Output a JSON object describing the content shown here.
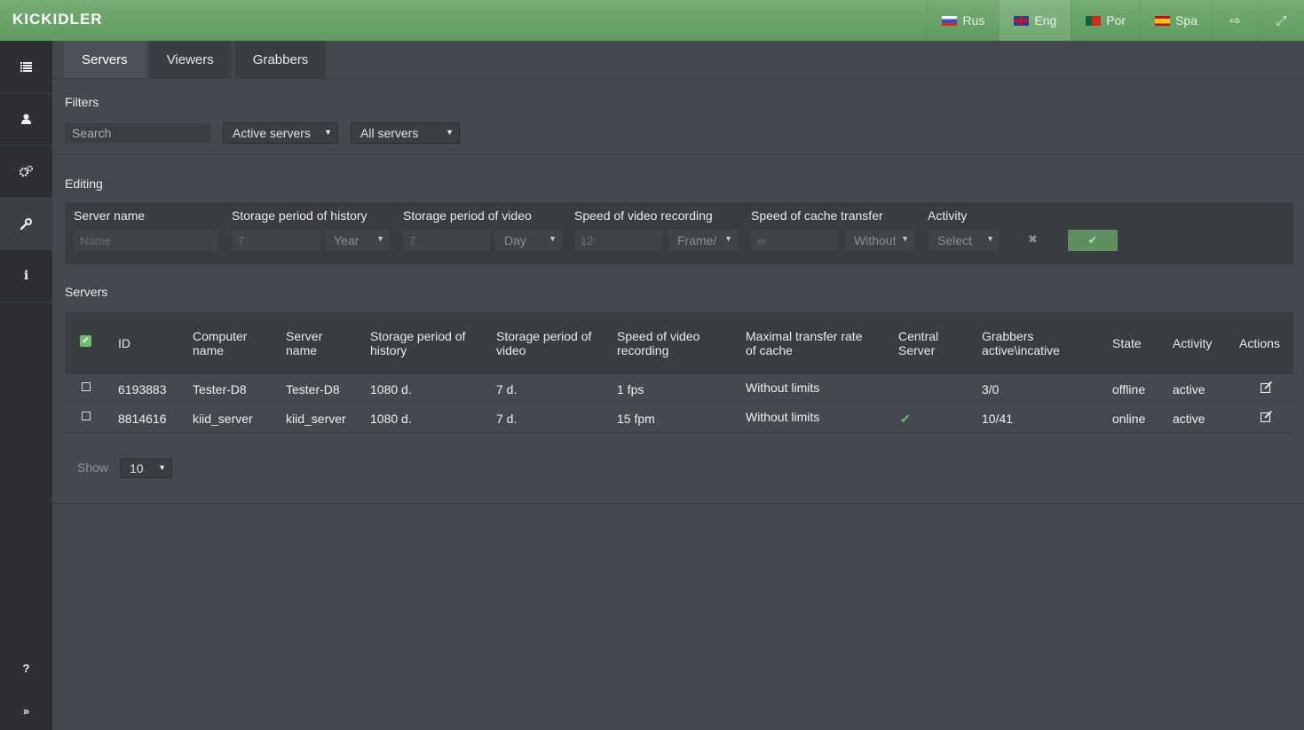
{
  "app": {
    "logo": "KICKIDLER"
  },
  "topbar": {
    "languages": [
      {
        "label": "Rus",
        "flag": "ru-flag-icon"
      },
      {
        "label": "Eng",
        "flag": "gb-flag-icon"
      },
      {
        "label": "Por",
        "flag": "pt-flag-icon"
      },
      {
        "label": "Spa",
        "flag": "es-flag-icon"
      }
    ],
    "active_language": "Eng",
    "logout_icon": "⇨",
    "fullscreen_icon": "⤢"
  },
  "sidebar": {
    "items": [
      {
        "name": "list-icon",
        "glyph": "☰"
      },
      {
        "name": "user-icon",
        "glyph": "👤"
      },
      {
        "name": "gears-icon",
        "glyph": "⚙"
      },
      {
        "name": "wrench-icon",
        "glyph": "🔧"
      },
      {
        "name": "info-icon",
        "glyph": "i"
      }
    ],
    "help": "?",
    "expand": "»"
  },
  "tabs": [
    "Servers",
    "Viewers",
    "Grabbers"
  ],
  "filters": {
    "title": "Filters",
    "search_placeholder": "Search",
    "status_select": "Active servers",
    "type_select": "All servers"
  },
  "editing": {
    "title": "Editing",
    "labels": {
      "server_name": "Server name",
      "history": "Storage period of history",
      "video": "Storage period of video",
      "recording": "Speed of video recording",
      "cache": "Speed of cache transfer",
      "activity": "Activity"
    },
    "values": {
      "name_placeholder": "Name",
      "history_value": "7",
      "history_unit": "Year",
      "video_value": "7",
      "video_unit": "Day",
      "recording_value": "12",
      "recording_unit": "Frame/",
      "cache_value": "∞",
      "cache_unit": "Without",
      "activity_select": "Select"
    },
    "cancel": "✖",
    "confirm": "✔"
  },
  "servers": {
    "title": "Servers",
    "columns": {
      "id": "ID",
      "computer_name": [
        "Computer",
        "name"
      ],
      "server_name": [
        "Server",
        "name"
      ],
      "history": [
        "Storage period of",
        "history"
      ],
      "video": [
        "Storage period of",
        "video"
      ],
      "recording": [
        "Speed of video",
        "recording"
      ],
      "cache": [
        "Maximal transfer rate",
        "of cache"
      ],
      "central": [
        "Central",
        "Server"
      ],
      "grabbers": [
        "Grabbers",
        "active\\incative"
      ],
      "state": "State",
      "activity": "Activity",
      "actions": "Actions"
    },
    "rows": [
      {
        "id": "6193883",
        "computer": "Tester-D8",
        "server": "Tester-D8",
        "history": "1080 d.",
        "video": "7 d.",
        "recording": "1 fps",
        "cache": "Without limits",
        "central": "",
        "grabbers": "3/0",
        "state": "offline",
        "activity": "active"
      },
      {
        "id": "8814616",
        "computer": "kiid_server",
        "server": "kiid_server",
        "history": "1080 d.",
        "video": "7 d.",
        "recording": "15 fpm",
        "cache": "Without limits",
        "central": "✔",
        "grabbers": "10/41",
        "state": "online",
        "activity": "active"
      }
    ],
    "show_label": "Show",
    "show_value": "10"
  }
}
